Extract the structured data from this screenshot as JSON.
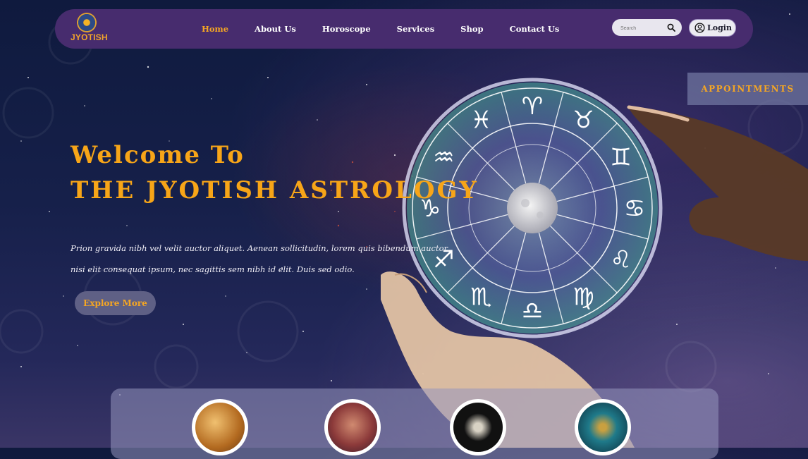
{
  "header": {
    "logo_text": "JYOTISH",
    "nav": [
      {
        "label": "Home",
        "active": true
      },
      {
        "label": "About Us",
        "active": false
      },
      {
        "label": "Horoscope",
        "active": false
      },
      {
        "label": "Services",
        "active": false
      },
      {
        "label": "Shop",
        "active": false
      },
      {
        "label": "Contact Us",
        "active": false
      }
    ],
    "search_placeholder": "Search",
    "login_label": "Login"
  },
  "appointments_label": "APPOINTMENTS",
  "hero": {
    "title_line1": "Welcome To",
    "title_line2": "THE JYOTISH ASTROLOGY",
    "description": "Prion gravida nibh vel velit auctor aliquet. Aenean sollicitudin, lorem quis bibendum auctor, nisi elit consequat ipsum, nec sagittis sem nibh id elit. Duis sed odio.",
    "cta_label": "Explore More"
  },
  "zodiac_signs": [
    "♓",
    "♈",
    "♉",
    "♊",
    "♋",
    "♌",
    "♍",
    "♎",
    "♏",
    "♐",
    "♑",
    "♒"
  ],
  "services_thumbnails": [
    "compass-map-image",
    "tarot-cards-image",
    "skeleton-couple-image",
    "astrolabe-image"
  ],
  "colors": {
    "accent": "#f5a623",
    "header_bg": "#472c6e",
    "button_bg": "#5f6085"
  }
}
